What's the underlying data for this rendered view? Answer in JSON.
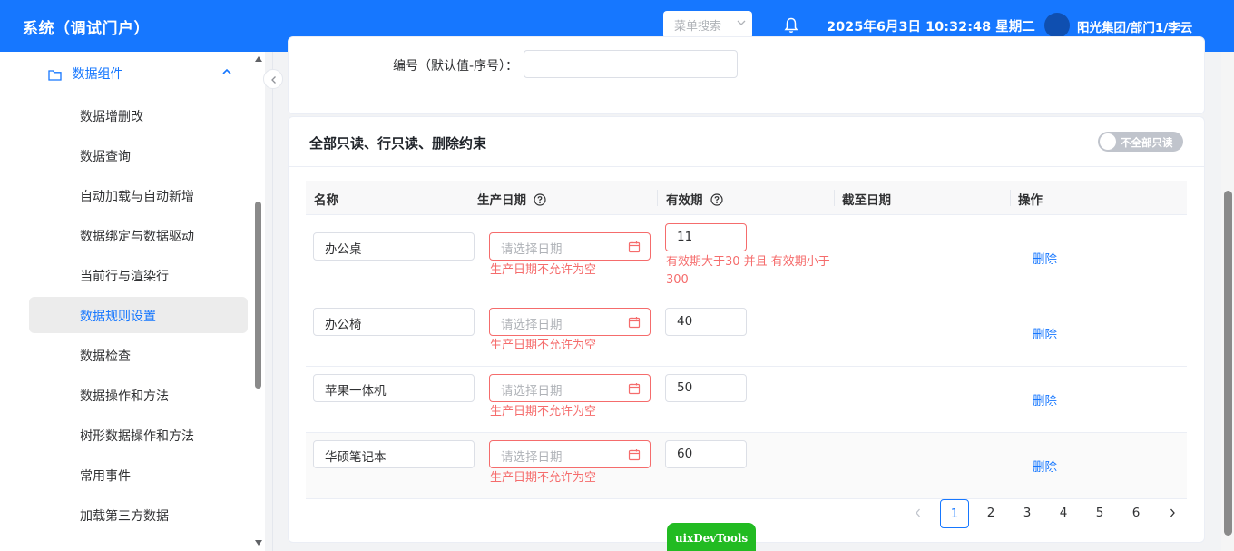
{
  "header": {
    "title": "系统（调试门户）",
    "menu_search_placeholder": "菜单搜索",
    "datetime": "2025年6月3日 10:32:48 星期二",
    "user": "阳光集团/部门1/李云"
  },
  "sidebar": {
    "group_label": "数据组件",
    "items": [
      {
        "label": "数据增删改"
      },
      {
        "label": "数据查询"
      },
      {
        "label": "自动加载与自动新增"
      },
      {
        "label": "数据绑定与数据驱动"
      },
      {
        "label": "当前行与渲染行"
      },
      {
        "label": "数据规则设置"
      },
      {
        "label": "数据检查"
      },
      {
        "label": "数据操作和方法"
      },
      {
        "label": "树形数据操作和方法"
      },
      {
        "label": "常用事件"
      },
      {
        "label": "加载第三方数据"
      }
    ],
    "active_item": "数据规则设置"
  },
  "top_form": {
    "code_label": "编号（默认值-序号）："
  },
  "card": {
    "title": "全部只读、行只读、删除约束",
    "switch_label": "不全部只读",
    "switch_on": false
  },
  "table": {
    "columns": [
      "名称",
      "生产日期",
      "有效期",
      "截至日期",
      "操作"
    ],
    "date_placeholder": "请选择日期",
    "rows": [
      {
        "name": "办公桌",
        "date_error": "生产日期不允许为空",
        "validity": "11",
        "validity_error": "有效期大于30 并且 有效期小于300",
        "action": "删除"
      },
      {
        "name": "办公椅",
        "date_error": "生产日期不允许为空",
        "validity": "40",
        "validity_error": "",
        "action": "删除"
      },
      {
        "name": "苹果一体机",
        "date_error": "生产日期不允许为空",
        "validity": "50",
        "validity_error": "",
        "action": "删除"
      },
      {
        "name": "华硕笔记本",
        "date_error": "生产日期不允许为空",
        "validity": "60",
        "validity_error": "",
        "action": "删除"
      }
    ]
  },
  "pagination": {
    "pages": [
      "1",
      "2",
      "3",
      "4",
      "5",
      "6"
    ],
    "current": "1"
  },
  "devtools_label": "uixDevTools",
  "colors": {
    "primary": "#1677ff",
    "error": "#f56c6c",
    "devtools": "#22bb22"
  }
}
